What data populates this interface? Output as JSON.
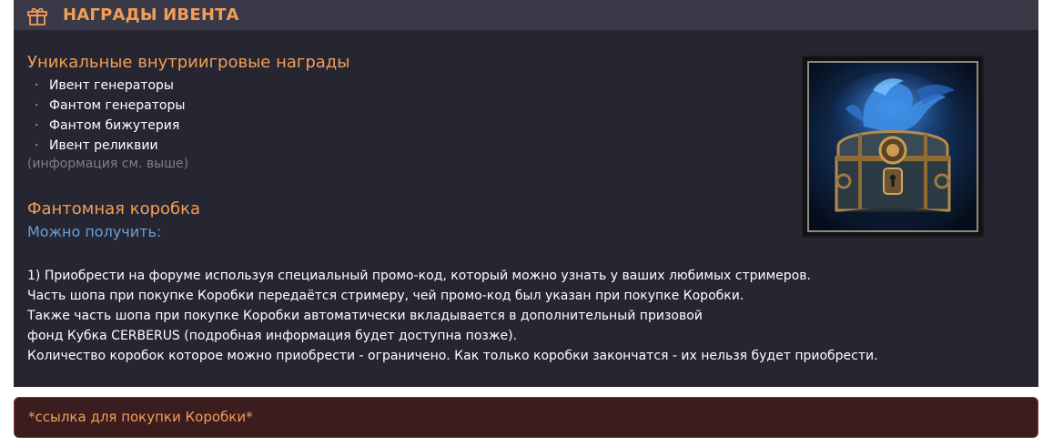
{
  "header": {
    "title": "НАГРАДЫ ИВЕНТА",
    "icon": "gift-icon"
  },
  "unique": {
    "title": "Уникальные внутриигровые награды",
    "items": [
      "Ивент генераторы",
      "Фантом генераторы",
      "Фантом бижутерия",
      "Ивент реликвии"
    ],
    "bullet": "·",
    "note": "(информация см. выше)"
  },
  "phantom": {
    "title": "Фантомная коробка",
    "subtitle": "Можно получить:",
    "lines": [
      "1) Приобрести на форуме используя специальный промо-код, который можно узнать у ваших любимых стримеров.",
      "Часть шопа при покупке Коробки передаётся стримеру, чей промо-код был указан при покупке Коробки.",
      "Также часть шопа при покупке Коробки автоматически вкладывается в дополнительный призовой",
      "фонд Кубка CERBERUS (подробная информация будет доступна позже).",
      "Количество коробок которое можно приобрести - ограничено. Как только коробки закончатся - их нельзя будет приобрести."
    ]
  },
  "image": {
    "icon": "dragon-chest-image"
  },
  "link": {
    "text": "*ссылка для покупки Коробки*"
  },
  "colors": {
    "accent": "#f39d55",
    "subtitle": "#6a9ed6",
    "panel": "#252632",
    "header": "#393948",
    "link_bg": "#3b1d1f"
  }
}
